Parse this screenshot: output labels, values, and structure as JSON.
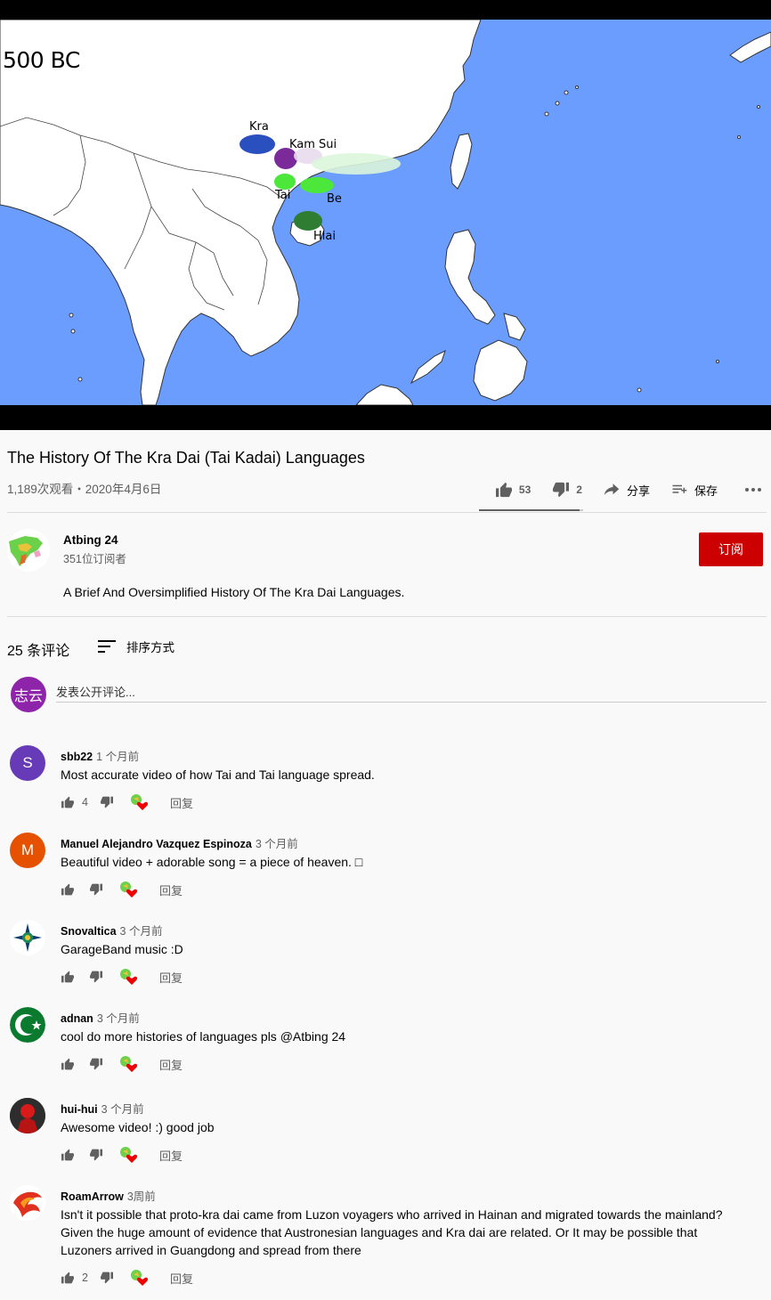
{
  "video": {
    "frame_year": "500 BC",
    "map_labels": {
      "kra": "Kra",
      "kam_sui": "Kam Sui",
      "tai": "Tai",
      "be": "Be",
      "hlai": "Hlai"
    },
    "title": "The History Of The Kra Dai (Tai Kadai) Languages",
    "meta": "1,189次观看・2020年4月6日",
    "likes": "53",
    "dislikes": "2",
    "like_ratio": 0.964,
    "share_label": "分享",
    "save_label": "保存"
  },
  "owner": {
    "name": "Atbing 24",
    "subscribers": "351位订阅者",
    "subscribe_label": "订阅",
    "description": "A Brief And Oversimplified History Of The Kra Dai Languages."
  },
  "comments_section": {
    "count_label": "25 条评论",
    "sort_label": "排序方式",
    "my_avatar_text": "志云",
    "input_placeholder": "发表公开评论...",
    "reply_label": "回复"
  },
  "comments": [
    {
      "author": "sbb22",
      "time": "1 个月前",
      "text": "Most accurate video of how Tai and Tai language spread.",
      "likes": "4",
      "avatar_letter": "S",
      "avatar_color": "#673ab7"
    },
    {
      "author": "Manuel Alejandro Vazquez Espinoza",
      "time": "3 个月前",
      "text": "Beautiful video + adorable song = a piece of heaven. □",
      "likes": "",
      "avatar_letter": "M",
      "avatar_color": "#e65100"
    },
    {
      "author": "Snovaltica",
      "time": "3 个月前",
      "text": "GarageBand music :D",
      "likes": ""
    },
    {
      "author": "adnan",
      "time": "3 个月前",
      "text": "cool do more histories of languages pls @Atbing 24",
      "likes": ""
    },
    {
      "author": "hui-hui",
      "time": "3 个月前",
      "text": "Awesome video! :) good job",
      "likes": ""
    },
    {
      "author": "RoamArrow",
      "time": "3周前",
      "text": "Isn't it possible that proto-kra dai came from Luzon voyagers who arrived in Hainan and migrated towards the mainland? Given the huge amount of evidence that Austronesian languages and Kra dai are related. Or It may be possible that Luzoners arrived in Guangdong and spread from there",
      "likes": "2"
    }
  ],
  "colors": {
    "subscribe_red": "#cc0000",
    "ocean_blue": "#6b9dff",
    "kra_blue": "#2a4fbf",
    "kam_sui_purple": "#7b2a9a",
    "tai_green": "#4de63a",
    "hlai_green": "#2e7d32"
  }
}
